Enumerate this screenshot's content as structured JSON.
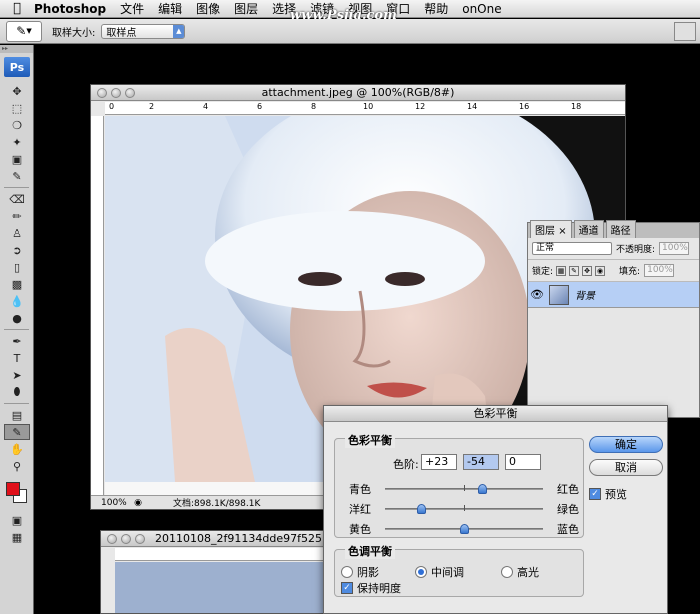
{
  "menubar": {
    "app_name": "Photoshop",
    "items": [
      "文件",
      "编辑",
      "图像",
      "图层",
      "选择",
      "滤镜",
      "视图",
      "窗口",
      "帮助",
      "onOne"
    ],
    "watermark": "www.Psjia.com"
  },
  "options_bar": {
    "sample_size_label": "取样大小:",
    "sample_size_value": "取样点"
  },
  "tools": {
    "logo": "Ps",
    "foreground_color": "#e0101a",
    "background_color": "#ffffff"
  },
  "document": {
    "title": "attachment.jpeg @ 100%(RGB/8#)",
    "ruler_ticks": [
      "0",
      "2",
      "4",
      "6",
      "8",
      "10",
      "12",
      "14",
      "16",
      "18"
    ],
    "zoom": "100%",
    "doc_info": "文档:898.1K/898.1K"
  },
  "document2": {
    "title": "20110108_2f91134dde97f525"
  },
  "layers_panel": {
    "tabs": [
      "图层",
      "通道",
      "路径"
    ],
    "blend_mode": "正常",
    "opacity_label": "不透明度:",
    "opacity_value": "100%",
    "lock_label": "锁定:",
    "fill_label": "填充:",
    "fill_value": "100%",
    "layer_name": "背景"
  },
  "color_balance": {
    "title": "色彩平衡",
    "group_label": "色彩平衡",
    "levels_label": "色阶:",
    "levels": [
      "+23",
      "-54",
      "0"
    ],
    "sliders": [
      {
        "left": "青色",
        "right": "红色",
        "value": 23
      },
      {
        "left": "洋红",
        "right": "绿色",
        "value": -54
      },
      {
        "left": "黄色",
        "right": "蓝色",
        "value": 0
      }
    ],
    "tone_group_label": "色调平衡",
    "tones": [
      "阴影",
      "中间调",
      "高光"
    ],
    "selected_tone": "中间调",
    "preserve_luminosity": "保持明度",
    "ok": "确定",
    "cancel": "取消",
    "preview": "预览"
  }
}
